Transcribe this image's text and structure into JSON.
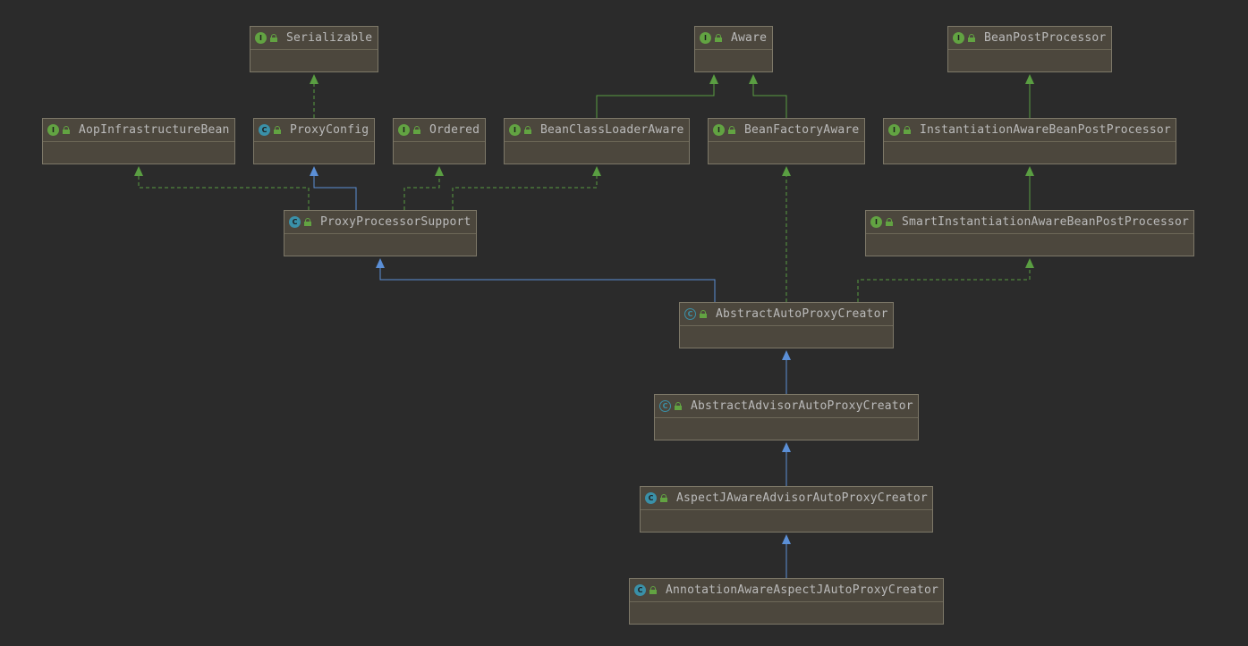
{
  "diagram": {
    "nodes": [
      {
        "id": "serializable",
        "name": "Serializable",
        "kind": "interface"
      },
      {
        "id": "aware",
        "name": "Aware",
        "kind": "interface"
      },
      {
        "id": "beanpostprocessor",
        "name": "BeanPostProcessor",
        "kind": "interface"
      },
      {
        "id": "aopinfrastructurebean",
        "name": "AopInfrastructureBean",
        "kind": "interface"
      },
      {
        "id": "proxyconfig",
        "name": "ProxyConfig",
        "kind": "class"
      },
      {
        "id": "ordered",
        "name": "Ordered",
        "kind": "interface"
      },
      {
        "id": "beanclassloaderaware",
        "name": "BeanClassLoaderAware",
        "kind": "interface"
      },
      {
        "id": "beanfactoryaware",
        "name": "BeanFactoryAware",
        "kind": "interface"
      },
      {
        "id": "instantiationawarebeanpostprocessor",
        "name": "InstantiationAwareBeanPostProcessor",
        "kind": "interface"
      },
      {
        "id": "proxyprocessorsupport",
        "name": "ProxyProcessorSupport",
        "kind": "class"
      },
      {
        "id": "smartinstantiationawarebeanpostprocessor",
        "name": "SmartInstantiationAwareBeanPostProcessor",
        "kind": "interface"
      },
      {
        "id": "abstractautoproxycreator",
        "name": "AbstractAutoProxyCreator",
        "kind": "abstract"
      },
      {
        "id": "abstractadvisorautoproxycreator",
        "name": "AbstractAdvisorAutoProxyCreator",
        "kind": "abstract"
      },
      {
        "id": "aspectjawareadvisorautoproxycreator",
        "name": "AspectJAwareAdvisorAutoProxyCreator",
        "kind": "class"
      },
      {
        "id": "annotationawareaspectjautoproxycreator",
        "name": "AnnotationAwareAspectJAutoProxyCreator",
        "kind": "class"
      }
    ],
    "edges": [
      {
        "from": "proxyconfig",
        "to": "serializable",
        "type": "implements"
      },
      {
        "from": "beanclassloaderaware",
        "to": "aware",
        "type": "extends-interface"
      },
      {
        "from": "beanfactoryaware",
        "to": "aware",
        "type": "extends-interface"
      },
      {
        "from": "instantiationawarebeanpostprocessor",
        "to": "beanpostprocessor",
        "type": "extends-interface"
      },
      {
        "from": "proxyprocessorsupport",
        "to": "aopinfrastructurebean",
        "type": "implements"
      },
      {
        "from": "proxyprocessorsupport",
        "to": "proxyconfig",
        "type": "extends"
      },
      {
        "from": "proxyprocessorsupport",
        "to": "ordered",
        "type": "implements"
      },
      {
        "from": "proxyprocessorsupport",
        "to": "beanclassloaderaware",
        "type": "implements"
      },
      {
        "from": "smartinstantiationawarebeanpostprocessor",
        "to": "instantiationawarebeanpostprocessor",
        "type": "extends-interface"
      },
      {
        "from": "abstractautoproxycreator",
        "to": "proxyprocessorsupport",
        "type": "extends"
      },
      {
        "from": "abstractautoproxycreator",
        "to": "beanfactoryaware",
        "type": "implements"
      },
      {
        "from": "abstractautoproxycreator",
        "to": "smartinstantiationawarebeanpostprocessor",
        "type": "implements"
      },
      {
        "from": "abstractadvisorautoproxycreator",
        "to": "abstractautoproxycreator",
        "type": "extends"
      },
      {
        "from": "aspectjawareadvisorautoproxycreator",
        "to": "abstractadvisorautoproxycreator",
        "type": "extends"
      },
      {
        "from": "annotationawareaspectjautoproxycreator",
        "to": "aspectjawareadvisorautoproxycreator",
        "type": "extends"
      }
    ]
  },
  "badges": {
    "interface": "I",
    "class": "C",
    "abstract": "C"
  },
  "colors": {
    "background": "#2b2b2b",
    "node_fill": "#4c473d",
    "node_border": "#7d7868",
    "interface_badge": "#62a342",
    "class_badge": "#3a90a8",
    "extends_edge": "#5b8fd6",
    "implements_edge": "#5a9e42",
    "text": "#bbbbbb"
  }
}
